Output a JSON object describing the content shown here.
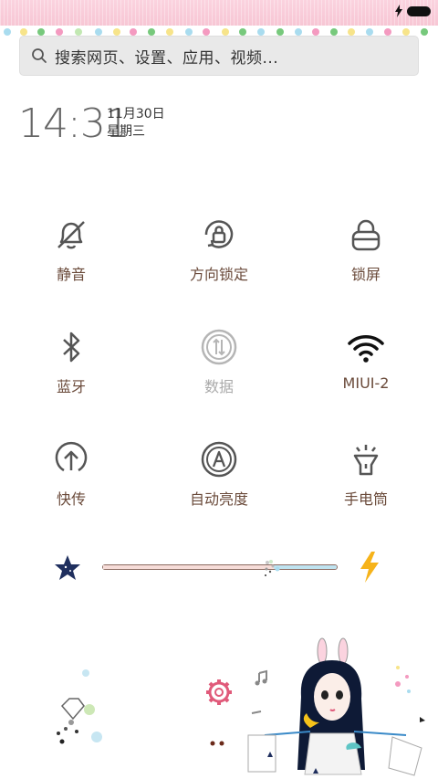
{
  "search": {
    "placeholder": "搜索网页、设置、应用、视频..."
  },
  "clock": {
    "time": "14:31",
    "date": "11月30日",
    "weekday": "星期三"
  },
  "toggles": [
    {
      "label": "静音",
      "icon": "mute-bell-icon",
      "active": false
    },
    {
      "label": "方向锁定",
      "icon": "rotation-lock-icon",
      "active": false
    },
    {
      "label": "锁屏",
      "icon": "lock-icon",
      "active": false
    },
    {
      "label": "蓝牙",
      "icon": "bluetooth-icon",
      "active": false
    },
    {
      "label": "数据",
      "icon": "mobile-data-icon",
      "active": false
    },
    {
      "label": "MIUI-2",
      "icon": "wifi-icon",
      "active": true
    },
    {
      "label": "快传",
      "icon": "quick-transfer-icon",
      "active": false
    },
    {
      "label": "自动亮度",
      "icon": "auto-brightness-icon",
      "active": false
    },
    {
      "label": "手电筒",
      "icon": "flashlight-icon",
      "active": false
    }
  ],
  "brightness": {
    "level": 0.73
  },
  "colors": {
    "label": "#6a4a3a",
    "icon": "#555555",
    "disabled": "#aaaaaa",
    "status_bar": "#f7c6d4"
  }
}
